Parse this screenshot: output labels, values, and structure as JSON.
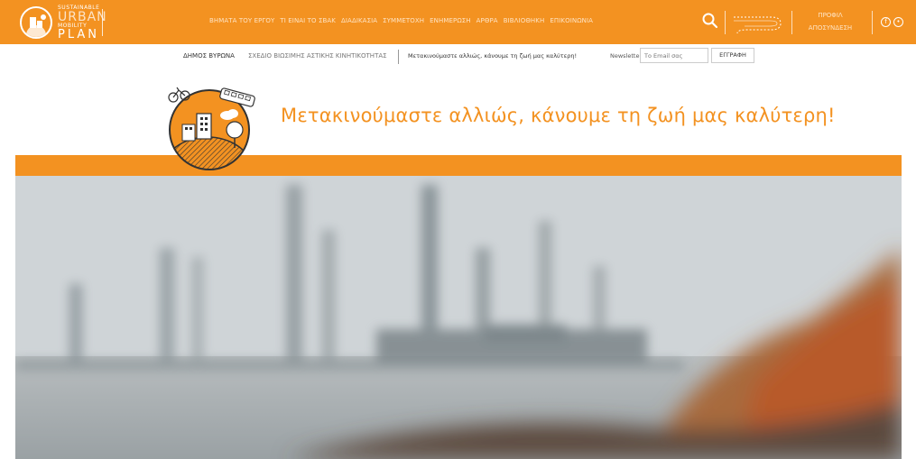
{
  "logo": {
    "small": "SUSTAINABLE",
    "urban": "URBAN",
    "mobility": "MOBILITY",
    "plan": "PLAN"
  },
  "nav": {
    "items": [
      "ΒΗΜΑΤΑ ΤΟΥ ΕΡΓΟΥ",
      "ΤΙ ΕΙΝΑΙ ΤΟ ΣΒΑΚ",
      "ΔΙΑΔΙΚΑΣΙΑ",
      "ΣΥΜΜΕΤΟΧΗ",
      "ΕΝΗΜΕΡΩΣΗ",
      "ΑΡΘΡΑ",
      "ΒΙΒΛΙΟΘΗΚΗ",
      "ΕΠΙΚΟΙΝΩΝΙΑ"
    ]
  },
  "account": {
    "profile": "ΠΡΟΦΙΛ",
    "logout": "ΑΠΟΣΥΝΔΕΣΗ"
  },
  "icons": {
    "search": "search-icon",
    "route": "route-icon",
    "facebook": "facebook-icon",
    "other": "social-icon"
  },
  "subbar": {
    "municipality": "ΔΗΜΟΣ ΒΥΡΩΝΑ",
    "plan_name": "ΣΧΕΔΙΟ ΒΙΩΣΙΜΗΣ ΑΣΤΙΚΗΣ ΚΙΝΗΤΙΚΟΤΗΤΑΣ",
    "tagline": "Μετακινούμαστε αλλιώς, κάνουμε τη ζωή μας καλύτερη!",
    "newsletter_label": "Newsletter",
    "email_placeholder": "Το Email σας",
    "register_label": "ΕΓΓΡΑΦΗ"
  },
  "header": {
    "tagline": "Μετακινούμαστε αλλιώς, κάνουμε τη ζωή μας καλύτερη!"
  },
  "colors": {
    "brand": "#f39221",
    "nav_text": "#ffe4c4"
  }
}
